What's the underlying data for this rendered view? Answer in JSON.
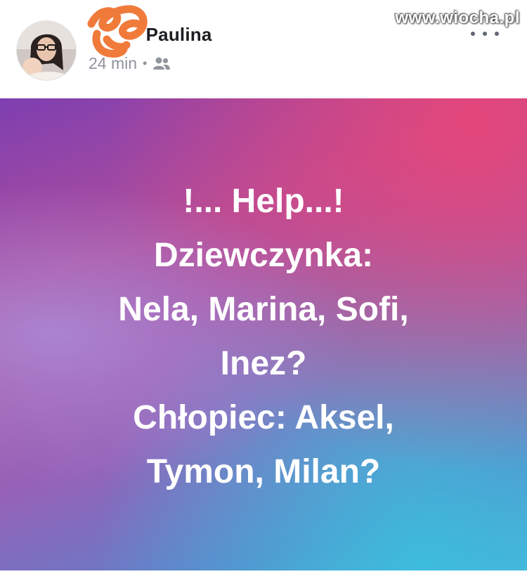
{
  "post": {
    "author_name": "Paulina",
    "timestamp": "24 min",
    "separator": "•",
    "audience_icon": "friends-icon",
    "more_icon": "more-horizontal-icon"
  },
  "watermark": "www.wiocha.pl",
  "content": {
    "lines": [
      "!... Help...!",
      "Dziewczynka:",
      "Nela, Marina, Sofi,",
      "Inez?",
      "Chłopiec: Aksel,",
      "Tymon, Milan?"
    ],
    "text_color": "#ffffff"
  },
  "colors": {
    "name": "#1c1e21",
    "meta": "#90949c",
    "scribble": "#f07a3a"
  }
}
